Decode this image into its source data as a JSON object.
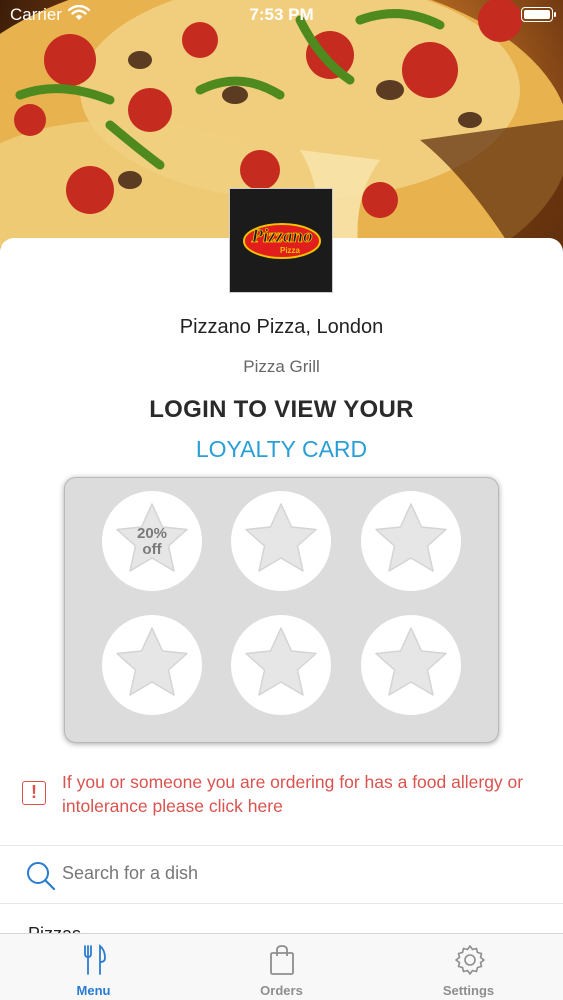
{
  "status_bar": {
    "carrier": "Carrier",
    "time": "7:53 PM"
  },
  "restaurant": {
    "logo_main": "Pizzano",
    "logo_sub": "Pizza",
    "name": "Pizzano Pizza, London",
    "type": "Pizza Grill"
  },
  "loyalty": {
    "title": "LOGIN TO VIEW YOUR",
    "link": "LOYALTY CARD",
    "reward_line1": "20%",
    "reward_line2": "off",
    "stamps_total": 6,
    "stamps_collected": 0
  },
  "allergy": {
    "text": "If you or someone you are ordering for has a food allergy or intolerance please click here"
  },
  "search": {
    "placeholder": "Search for a dish"
  },
  "menu": {
    "first_category": "Pizzas"
  },
  "tab_bar": {
    "tabs": [
      {
        "label": "Menu",
        "icon": "menu-icon",
        "active": true
      },
      {
        "label": "Orders",
        "icon": "bag-icon",
        "active": false
      },
      {
        "label": "Settings",
        "icon": "gear-icon",
        "active": false
      }
    ]
  },
  "colors": {
    "accent": "#2a9fd6",
    "tab_active": "#2a7bd1",
    "alert": "#d9534f",
    "card_bg": "#dcdcdd"
  }
}
